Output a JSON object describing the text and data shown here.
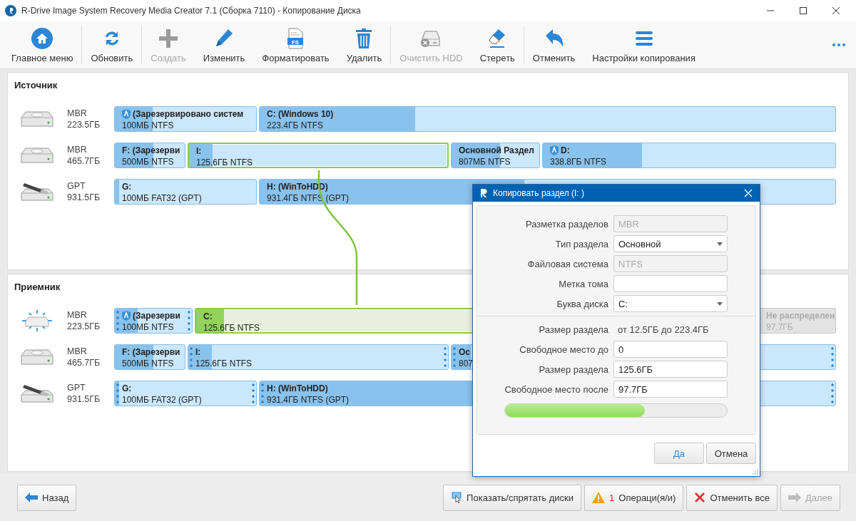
{
  "window": {
    "title": "R-Drive Image System Recovery Media Creator 7.1 (Сборка 7110) - Копирование Диска"
  },
  "toolbar": [
    {
      "label": "Главное меню",
      "disabled": false
    },
    {
      "label": "Обновить",
      "disabled": false
    },
    {
      "label": "Создать",
      "disabled": true
    },
    {
      "label": "Изменить",
      "disabled": false
    },
    {
      "label": "Форматировать",
      "disabled": false,
      "icon_text": "FS"
    },
    {
      "label": "Удалить",
      "disabled": false
    },
    {
      "label": "Очистить HDD",
      "disabled": true
    },
    {
      "label": "Стереть",
      "disabled": false
    },
    {
      "label": "Отменить",
      "disabled": false
    },
    {
      "label": "Настройки копирования",
      "disabled": false
    }
  ],
  "source": {
    "title": "Источник",
    "disks": [
      {
        "kind": "hdd",
        "scheme": "MBR",
        "size": "223.5ГБ",
        "partitions": [
          {
            "kind": "partition",
            "name": "(Зарезервировано систем",
            "info": "100МБ NTFS",
            "level": 0.27,
            "active": true,
            "selected": false
          },
          {
            "kind": "partition",
            "name": "C: (Windows 10)",
            "info": "223.4ГБ NTFS",
            "level": 0.27,
            "active": false,
            "selected": false
          }
        ]
      },
      {
        "kind": "hdd",
        "scheme": "MBR",
        "size": "465.7ГБ",
        "partitions": [
          {
            "kind": "partition",
            "name": "F: (Зарезерви",
            "info": "500МБ NTFS",
            "level": 0.55,
            "active": false,
            "selected": false
          },
          {
            "kind": "partition",
            "name": "I:",
            "info": "125.6ГБ NTFS",
            "level": 0.09,
            "active": false,
            "selected": true
          },
          {
            "kind": "partition",
            "name": "Основной Раздел",
            "info": "807МБ NTFS",
            "level": 0.55,
            "active": false,
            "selected": false
          },
          {
            "kind": "partition",
            "name": "D:",
            "info": "338.8ГБ NTFS",
            "level": 0.34,
            "active": true,
            "selected": false
          }
        ]
      },
      {
        "kind": "usb",
        "scheme": "GPT",
        "size": "931.5ГБ",
        "partitions": [
          {
            "kind": "partition",
            "name": "G:",
            "info": "100МБ FAT32 (GPT)",
            "level": 0.03,
            "active": false,
            "selected": false
          },
          {
            "kind": "partition",
            "name": "H: (WinToHDD)",
            "info": "931.4ГБ NTFS (GPT)",
            "level": 0.46,
            "active": false,
            "selected": false
          }
        ]
      }
    ]
  },
  "target": {
    "title": "Приемник",
    "disks": [
      {
        "kind": "busy",
        "scheme": "MBR",
        "size": "223.5ГБ",
        "partitions": [
          {
            "kind": "partition",
            "name": "(Зарезерви",
            "info": "100МБ NTFS",
            "level": 0.3,
            "active": true,
            "selected": false,
            "handles": true
          },
          {
            "kind": "new",
            "name": "C:",
            "info": "125.6ГБ NTFS",
            "level": 0.05,
            "active": false,
            "selected": true,
            "handles": false
          },
          {
            "kind": "unallocated",
            "name": "Не распределен",
            "info": "97.7ГБ",
            "active": false,
            "selected": false,
            "handles": false
          }
        ]
      },
      {
        "kind": "hdd",
        "scheme": "MBR",
        "size": "465.7ГБ",
        "partitions": [
          {
            "kind": "partition",
            "name": "F: (Зарезерви",
            "info": "500МБ NTFS",
            "level": 0.55,
            "active": false,
            "selected": false,
            "handles": false
          },
          {
            "kind": "partition",
            "name": "I:",
            "info": "125.6ГБ NTFS",
            "level": 0.09,
            "active": false,
            "selected": false,
            "handles": true
          },
          {
            "kind": "partition",
            "name": "Ос",
            "info": "807",
            "level": 0.05,
            "active": false,
            "selected": false,
            "handles": true
          }
        ]
      },
      {
        "kind": "usb",
        "scheme": "GPT",
        "size": "931.5ГБ",
        "partitions": [
          {
            "kind": "partition",
            "name": "G:",
            "info": "100МБ FAT32 (GPT)",
            "level": 0.03,
            "active": false,
            "selected": false,
            "handles": true
          },
          {
            "kind": "partition",
            "name": "H: (WinToHDD)",
            "info": "931.4ГБ NTFS (GPT)",
            "level": 0.37,
            "active": false,
            "selected": false,
            "handles": true
          }
        ]
      }
    ]
  },
  "dialog": {
    "title": "Копировать раздел (I: )",
    "fields": [
      {
        "kind": "readonly",
        "label": "Разметка разделов",
        "value": "MBR"
      },
      {
        "kind": "select",
        "label": "Тип раздела",
        "value": "Основной"
      },
      {
        "kind": "readonly",
        "label": "Файловая система",
        "value": "NTFS"
      },
      {
        "kind": "input",
        "label": "Метка тома"
      },
      {
        "kind": "select",
        "label": "Буква диска",
        "value": "C:"
      }
    ],
    "size_fields": [
      {
        "kind": "text",
        "label": "Размер раздела",
        "value": "от  12.5ГБ  до  223.4ГБ"
      },
      {
        "kind": "input",
        "label": "Свободное место до",
        "value": "0"
      },
      {
        "kind": "input",
        "label": "Размер раздела",
        "value": "125.6ГБ"
      },
      {
        "kind": "input",
        "label": "Свободное место после",
        "value": "97.7ГБ"
      }
    ],
    "size_bar": {
      "level": 0.63
    },
    "buttons": [
      {
        "kind": "primary",
        "label": "Да"
      },
      {
        "kind": "normal",
        "label": "Отмена"
      }
    ]
  },
  "footer": {
    "back": {
      "label": "Назад"
    },
    "buttons": [
      {
        "kind": "disks",
        "label": "Показать/спрятать диски",
        "disabled": false
      },
      {
        "kind": "operations",
        "count": "1",
        "label": "Операци(я/и)",
        "disabled": false
      },
      {
        "kind": "cancel",
        "label": "Отменить все",
        "disabled": false
      },
      {
        "kind": "next",
        "label": "Далее",
        "disabled": true
      }
    ]
  }
}
